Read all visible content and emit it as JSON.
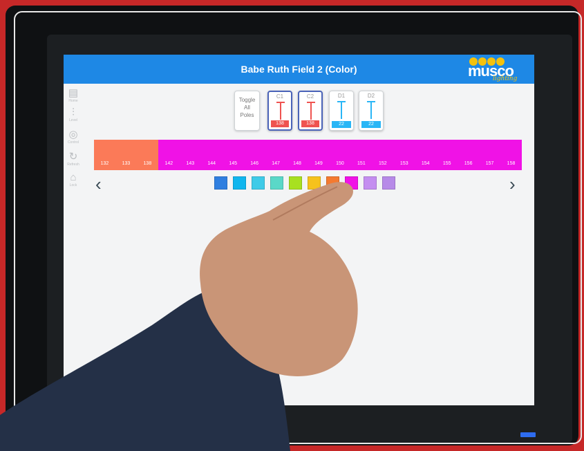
{
  "window": {
    "title": "Babe Ruth Field 2 (Color)"
  },
  "logo": {
    "word": "musco",
    "sub": "lighting"
  },
  "sidebar": {
    "items": [
      {
        "icon": "document-icon",
        "glyph": "▤",
        "label": "Home"
      },
      {
        "icon": "sliders-icon",
        "glyph": "⫶",
        "label": "Level"
      },
      {
        "icon": "pattern-icon",
        "glyph": "◎",
        "label": "Control"
      },
      {
        "icon": "refresh-icon",
        "glyph": "↻",
        "label": "Refresh"
      },
      {
        "icon": "lock-icon",
        "glyph": "⌂",
        "label": "Lock"
      }
    ]
  },
  "toggle": {
    "line1": "Toggle",
    "line2": "All",
    "line3": "Poles"
  },
  "poles": [
    {
      "name": "C1",
      "value": "138",
      "color": "#ef5350",
      "selected": true
    },
    {
      "name": "C2",
      "value": "138",
      "color": "#ef5350",
      "selected": true
    },
    {
      "name": "D1",
      "value": "22",
      "color": "#29b6f6",
      "selected": false
    },
    {
      "name": "D2",
      "value": "22",
      "color": "#29b6f6",
      "selected": false
    }
  ],
  "color_strip": {
    "labels": [
      "132",
      "133",
      "138",
      "142",
      "143",
      "144",
      "145",
      "146",
      "147",
      "148",
      "149",
      "150",
      "151",
      "152",
      "153",
      "154",
      "155",
      "156",
      "157",
      "158"
    ],
    "orange": "#fb7a58",
    "magenta": "#f012e6"
  },
  "swatches": [
    {
      "name": "blue",
      "color": "#2f7fe0"
    },
    {
      "name": "cyan",
      "color": "#10b6ee"
    },
    {
      "name": "sky",
      "color": "#3fcbe8"
    },
    {
      "name": "aqua",
      "color": "#5ad8c8"
    },
    {
      "name": "lime",
      "color": "#a8e020"
    },
    {
      "name": "yellow",
      "color": "#f6c21c"
    },
    {
      "name": "orange",
      "color": "#f47a30"
    },
    {
      "name": "magenta",
      "color": "#f012e6"
    },
    {
      "name": "violet",
      "color": "#c48ef0"
    },
    {
      "name": "lavender",
      "color": "#b78ae8"
    }
  ],
  "nav": {
    "prev": "‹",
    "next": "›"
  },
  "colors": {
    "titlebar": "#1e88e5",
    "background": "#c62828"
  }
}
